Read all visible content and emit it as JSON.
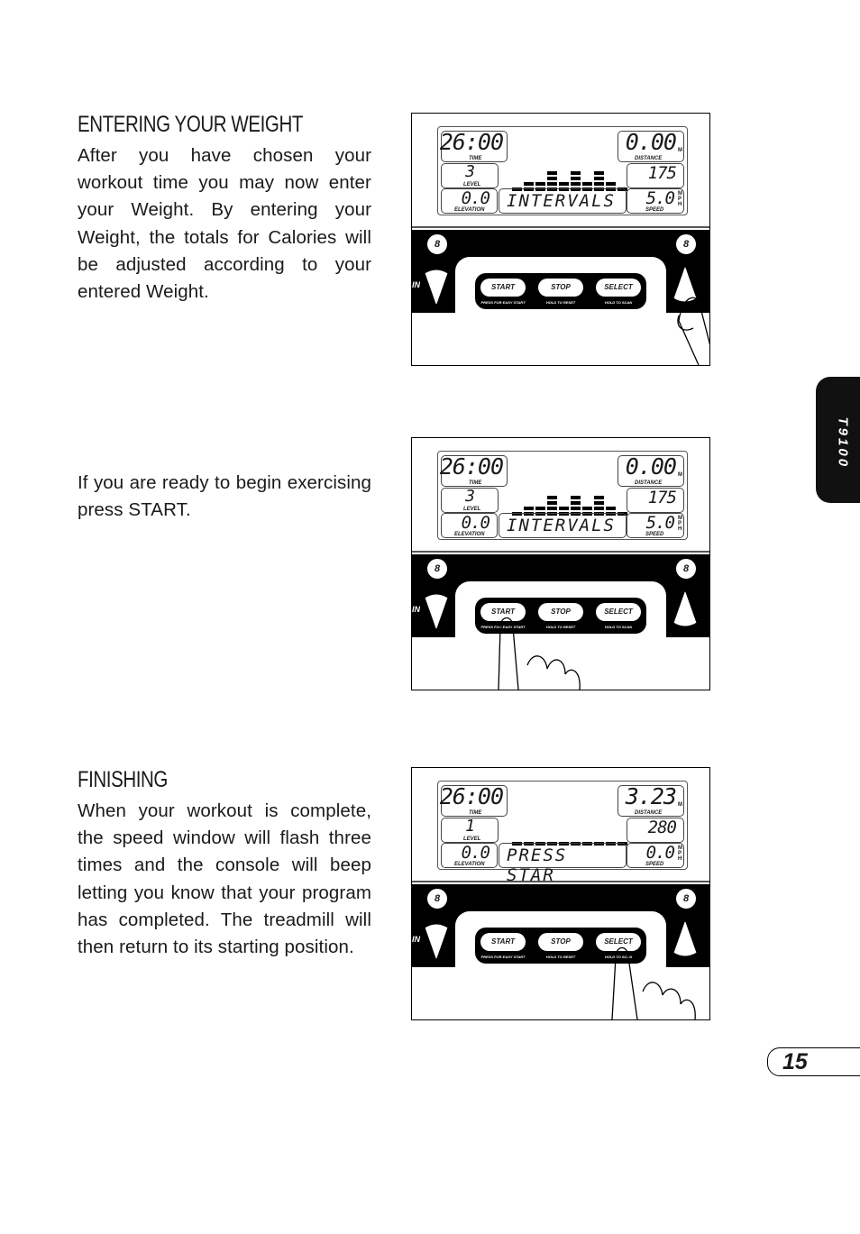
{
  "sections": [
    {
      "heading": "ENTERING YOUR WEIGHT",
      "text": "After you have chosen your workout time you may now enter your Weight. By entering your Weight, the totals for Calories will be adjusted according to your entered Weight."
    },
    {
      "heading": "",
      "text": "If you are ready to begin exercising press START."
    },
    {
      "heading": "FINISHING",
      "text": "When your workout is complete, the speed window will flash three times and the console will beep letting you know that your program has completed. The treadmill will then return to its starting position."
    }
  ],
  "console_labels": {
    "time": "TIME",
    "level": "LEVEL",
    "elevation": "ELEVATION",
    "distance": "DISTANCE",
    "speed": "SPEED",
    "distance_unit": "M",
    "speed_unit": "M P H",
    "start": "START",
    "stop": "STOP",
    "select": "SELECT",
    "start_caption": "PRESS FOR EASY START",
    "stop_caption": "HOLD TO RESET",
    "select_caption": "HOLD TO SCAN",
    "quick_key": "8",
    "left_edge": "IN"
  },
  "consoles": [
    {
      "time": "26:00",
      "level": "3",
      "elevation": "0.0",
      "message": "INTERVALS",
      "distance": "0.00",
      "calories": "175",
      "speed": "5.0",
      "profile": [
        1,
        2,
        2,
        4,
        2,
        4,
        2,
        4,
        2,
        1
      ],
      "finger_on": "speed-up"
    },
    {
      "time": "26:00",
      "level": "3",
      "elevation": "0.0",
      "message": "INTERVALS",
      "distance": "0.00",
      "calories": "175",
      "speed": "5.0",
      "profile": [
        1,
        2,
        2,
        4,
        2,
        4,
        2,
        4,
        2,
        1
      ],
      "finger_on": "start"
    },
    {
      "time": "26:00",
      "level": "1",
      "elevation": "0.0",
      "message": "PRESS STAR",
      "distance": "3.23",
      "calories": "280",
      "speed": "0.0",
      "profile": [
        1,
        1,
        1,
        1,
        1,
        1,
        1,
        1,
        1,
        1
      ],
      "finger_on": "select"
    }
  ],
  "side_tab": "T9100",
  "page_number": "15"
}
